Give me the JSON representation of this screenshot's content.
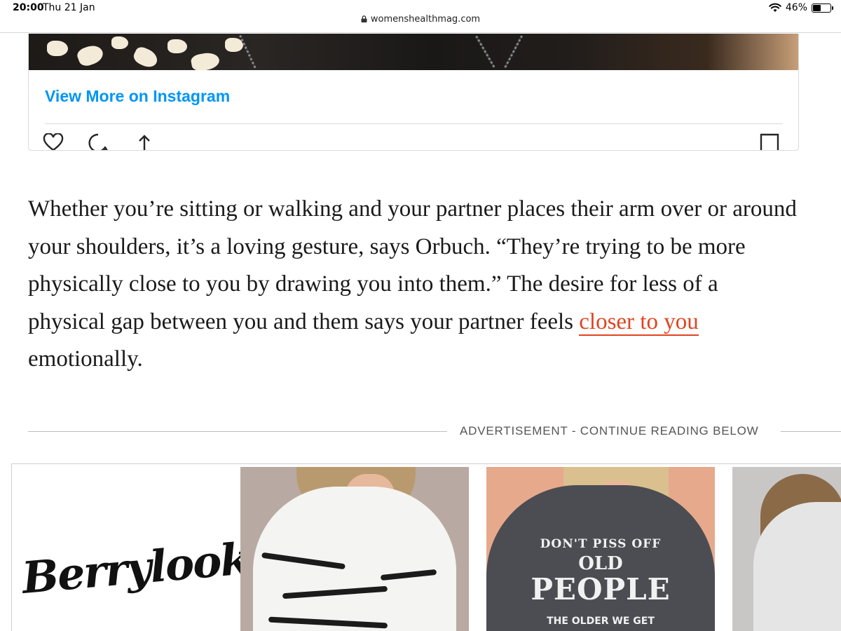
{
  "status_bar": {
    "time": "20:00",
    "date": "Thu 21 Jan",
    "battery": "46%",
    "battery_level": 0.46
  },
  "browser": {
    "url": "womenshealthmag.com"
  },
  "instagram_embed": {
    "link_label": "View More on Instagram",
    "icons": [
      "heart-icon",
      "comment-icon",
      "share-icon",
      "bookmark-icon"
    ],
    "accent_color": "#0095f6"
  },
  "article": {
    "text_before_link": "Whether you’re sitting or walking and your partner places their arm over or around your shoulders, it’s a loving gesture, says Orbuch. “They’re trying to be more physically close to you by drawing you into them.” The desire for less of a physical gap between you and them says your partner feels ",
    "link_text": "closer to you",
    "text_after_link": " emotionally.",
    "link_color": "#e0441f"
  },
  "advertisement": {
    "label": "ADVERTISEMENT - CONTINUE READING BELOW",
    "brand": "Berrylook",
    "products": [
      {
        "print_line1": "DON'T PISS OFF",
        "print_line2": "OLD",
        "print_line3": "PEOPLE",
        "print_line4": "THE OLDER WE GET"
      }
    ]
  }
}
